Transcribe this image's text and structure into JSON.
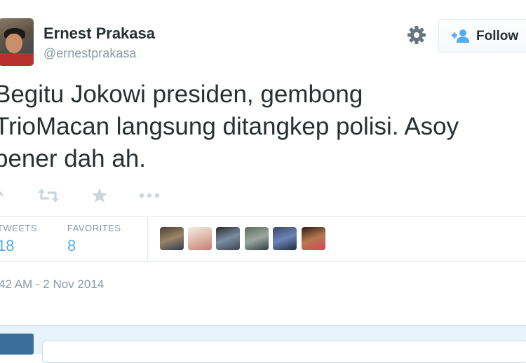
{
  "tweet": {
    "author": {
      "name": "Ernest Prakasa",
      "handle": "@ernestprakasa"
    },
    "follow_label": "Follow",
    "text_lines": [
      "Begitu Jokowi presiden, gembong",
      "TrioMacan langsung ditangkep polisi. Asoy",
      "bener dah ah."
    ],
    "stats": {
      "retweets_label": "TWEETS",
      "retweets_value": "18",
      "favorites_label": "FAVORITES",
      "favorites_value": "8"
    },
    "timestamp": "42 AM - 2 Nov 2014"
  },
  "icons": {
    "gear": "gear-icon",
    "follow": "add-user-icon",
    "reply": "reply-icon",
    "retweet": "retweet-icon",
    "favorite": "star-icon",
    "more": "more-icon"
  },
  "colors": {
    "text": "#292f33",
    "muted": "#8899a6",
    "link": "#55acee",
    "border": "#e1e8ed",
    "reply_bar": "#e8f4fb"
  }
}
